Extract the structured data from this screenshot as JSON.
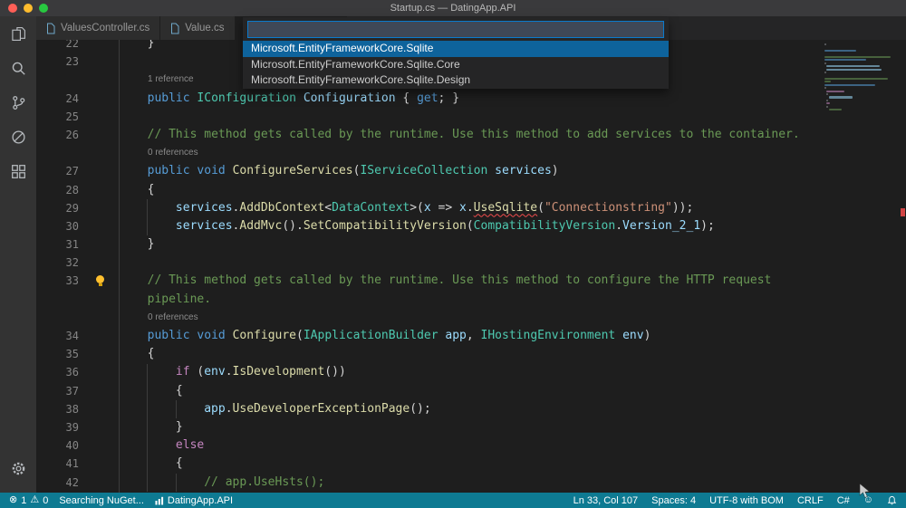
{
  "window": {
    "title": "Startup.cs — DatingApp.API"
  },
  "activity_bar": {
    "icons": [
      "files-icon",
      "search-icon",
      "source-control-icon",
      "debug-icon",
      "extensions-icon"
    ],
    "bottom_icons": [
      "settings-gear-icon"
    ]
  },
  "tabs": [
    {
      "label": "ValuesController.cs",
      "active": false
    },
    {
      "label": "Value.cs",
      "active": false
    },
    {
      "label": "",
      "active": true
    }
  ],
  "quick_input": {
    "value": "",
    "items": [
      {
        "label": "Microsoft.EntityFrameworkCore.Sqlite",
        "selected": true
      },
      {
        "label": "Microsoft.EntityFrameworkCore.Sqlite.Core",
        "selected": false
      },
      {
        "label": "Microsoft.EntityFrameworkCore.Sqlite.Design",
        "selected": false
      }
    ]
  },
  "editor": {
    "rows": [
      {
        "n": "22",
        "k": "c",
        "t": [
          [
            "        }",
            "pl"
          ]
        ]
      },
      {
        "n": "23",
        "k": "c",
        "t": []
      },
      {
        "k": "l",
        "lens": "1 reference"
      },
      {
        "n": "24",
        "k": "c",
        "t": [
          [
            "        ",
            "pl"
          ],
          [
            "public",
            "kw"
          ],
          [
            " ",
            "pl"
          ],
          [
            "IConfiguration",
            "ty"
          ],
          [
            " ",
            "pl"
          ],
          [
            "Configuration",
            "va"
          ],
          [
            " { ",
            "pl"
          ],
          [
            "get",
            "kw"
          ],
          [
            "; }",
            "pl"
          ]
        ]
      },
      {
        "n": "25",
        "k": "c",
        "t": []
      },
      {
        "n": "26",
        "k": "c",
        "t": [
          [
            "        ",
            "pl"
          ],
          [
            "// This method gets called by the runtime. Use this method to add services to the container.",
            "co"
          ]
        ]
      },
      {
        "k": "l",
        "lens": "0 references"
      },
      {
        "n": "27",
        "k": "c",
        "t": [
          [
            "        ",
            "pl"
          ],
          [
            "public",
            "kw"
          ],
          [
            " ",
            "pl"
          ],
          [
            "void",
            "kw"
          ],
          [
            " ",
            "pl"
          ],
          [
            "ConfigureServices",
            "fn"
          ],
          [
            "(",
            "pl"
          ],
          [
            "IServiceCollection",
            "ty"
          ],
          [
            " ",
            "pl"
          ],
          [
            "services",
            "va"
          ],
          [
            ")",
            "pl"
          ]
        ]
      },
      {
        "n": "28",
        "k": "c",
        "t": [
          [
            "        {",
            "pl"
          ]
        ]
      },
      {
        "n": "29",
        "k": "c",
        "t": [
          [
            "            ",
            "pl"
          ],
          [
            "services",
            "va"
          ],
          [
            ".",
            "pl"
          ],
          [
            "AddDbContext",
            "fn"
          ],
          [
            "<",
            "pl"
          ],
          [
            "DataContext",
            "ty"
          ],
          [
            ">(",
            "pl"
          ],
          [
            "x",
            "va"
          ],
          [
            " ",
            "pl"
          ],
          [
            "=>",
            "pl"
          ],
          [
            " ",
            "pl"
          ],
          [
            "x",
            "va"
          ],
          [
            ".",
            "pl"
          ],
          [
            "UseSqlite",
            "er"
          ],
          [
            "(",
            "pl"
          ],
          [
            "\"Connectionstring\"",
            "st"
          ],
          [
            "));",
            "pl"
          ]
        ]
      },
      {
        "n": "30",
        "k": "c",
        "t": [
          [
            "            ",
            "pl"
          ],
          [
            "services",
            "va"
          ],
          [
            ".",
            "pl"
          ],
          [
            "AddMvc",
            "fn"
          ],
          [
            "().",
            "pl"
          ],
          [
            "SetCompatibilityVersion",
            "fn"
          ],
          [
            "(",
            "pl"
          ],
          [
            "CompatibilityVersion",
            "ty"
          ],
          [
            ".",
            "pl"
          ],
          [
            "Version_2_1",
            "va"
          ],
          [
            ");",
            "pl"
          ]
        ]
      },
      {
        "n": "31",
        "k": "c",
        "t": [
          [
            "        }",
            "pl"
          ]
        ]
      },
      {
        "n": "32",
        "k": "c",
        "t": []
      },
      {
        "n": "33",
        "k": "c",
        "bulb": true,
        "t": [
          [
            "        ",
            "pl"
          ],
          [
            "// This method gets called by the runtime. Use this method to configure the HTTP request",
            "co"
          ]
        ]
      },
      {
        "n": "",
        "k": "c",
        "t": [
          [
            "        ",
            "pl"
          ],
          [
            "pipeline.",
            "co"
          ]
        ]
      },
      {
        "k": "l",
        "lens": "0 references"
      },
      {
        "n": "34",
        "k": "c",
        "t": [
          [
            "        ",
            "pl"
          ],
          [
            "public",
            "kw"
          ],
          [
            " ",
            "pl"
          ],
          [
            "void",
            "kw"
          ],
          [
            " ",
            "pl"
          ],
          [
            "Configure",
            "fn"
          ],
          [
            "(",
            "pl"
          ],
          [
            "IApplicationBuilder",
            "ty"
          ],
          [
            " ",
            "pl"
          ],
          [
            "app",
            "va"
          ],
          [
            ", ",
            "pl"
          ],
          [
            "IHostingEnvironment",
            "ty"
          ],
          [
            " ",
            "pl"
          ],
          [
            "env",
            "va"
          ],
          [
            ")",
            "pl"
          ]
        ]
      },
      {
        "n": "35",
        "k": "c",
        "t": [
          [
            "        {",
            "pl"
          ]
        ]
      },
      {
        "n": "36",
        "k": "c",
        "t": [
          [
            "            ",
            "pl"
          ],
          [
            "if",
            "ct"
          ],
          [
            " (",
            "pl"
          ],
          [
            "env",
            "va"
          ],
          [
            ".",
            "pl"
          ],
          [
            "IsDevelopment",
            "fn"
          ],
          [
            "())",
            "pl"
          ]
        ]
      },
      {
        "n": "37",
        "k": "c",
        "t": [
          [
            "            {",
            "pl"
          ]
        ]
      },
      {
        "n": "38",
        "k": "c",
        "t": [
          [
            "                ",
            "pl"
          ],
          [
            "app",
            "va"
          ],
          [
            ".",
            "pl"
          ],
          [
            "UseDeveloperExceptionPage",
            "fn"
          ],
          [
            "();",
            "pl"
          ]
        ]
      },
      {
        "n": "39",
        "k": "c",
        "t": [
          [
            "            }",
            "pl"
          ]
        ]
      },
      {
        "n": "40",
        "k": "c",
        "t": [
          [
            "            ",
            "pl"
          ],
          [
            "else",
            "ct"
          ]
        ]
      },
      {
        "n": "41",
        "k": "c",
        "t": [
          [
            "            {",
            "pl"
          ]
        ]
      },
      {
        "n": "42",
        "k": "c",
        "t": [
          [
            "                ",
            "pl"
          ],
          [
            "// app.UseHsts();",
            "co"
          ]
        ]
      }
    ]
  },
  "status_bar": {
    "errors": "1",
    "warnings": "0",
    "message": "Searching NuGet...",
    "project": "DatingApp.API",
    "cursor": "Ln 33, Col 107",
    "indent": "Spaces: 4",
    "encoding": "UTF-8 with BOM",
    "eol": "CRLF",
    "language": "C#"
  },
  "colors": {
    "statusbar_bg": "#0e7a92",
    "list_selection_bg": "#0e639c",
    "error_red": "#f14c4c",
    "token": {
      "pl": "#d4d4d4",
      "kw": "#569cd6",
      "ct": "#c586c0",
      "ty": "#4ec9b0",
      "fn": "#dcdcaa",
      "va": "#9cdcfe",
      "st": "#ce9178",
      "co": "#6a9955",
      "er": "#dcdcaa"
    }
  }
}
